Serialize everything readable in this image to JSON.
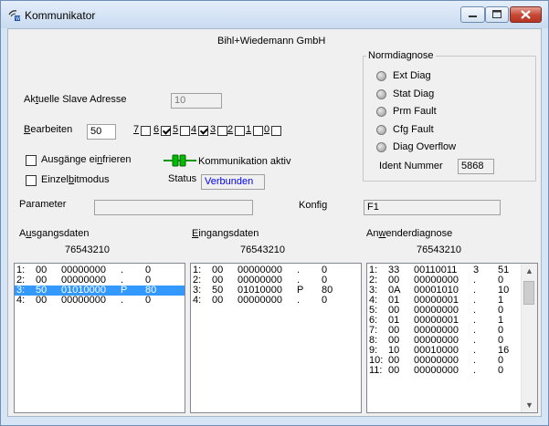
{
  "window": {
    "title": "Kommunikator"
  },
  "header": {
    "company": "Bihl+Wiedemann GmbH"
  },
  "slave": {
    "label_pre": "Ak",
    "label_u": "t",
    "label_post": "uelle Slave Adresse",
    "value": "10"
  },
  "edit": {
    "label_u": "B",
    "label_post": "earbeiten",
    "value": "50"
  },
  "bits": [
    {
      "label": "7",
      "checked": false
    },
    {
      "label": "6",
      "checked": true
    },
    {
      "label": "5",
      "checked": false
    },
    {
      "label": "4",
      "checked": true
    },
    {
      "label": "3",
      "checked": false
    },
    {
      "label": "2",
      "checked": false
    },
    {
      "label": "1",
      "checked": false
    },
    {
      "label": "0",
      "checked": false
    }
  ],
  "options": {
    "freeze_pre": "Ausgänge ei",
    "freeze_u": "n",
    "freeze_post": "frieren",
    "bit_pre": "Einzel",
    "bit_u": "b",
    "bit_post": "itmodus"
  },
  "comm": {
    "label": "Kommunikation aktiv",
    "status_label": "Status",
    "status_value": "Verbunden",
    "status_color": "#0000ff"
  },
  "norm": {
    "title": "Normdiagnose",
    "items": [
      "Ext Diag",
      "Stat Diag",
      "Prm Fault",
      "Cfg Fault",
      "Diag Overflow"
    ],
    "ident_label": "Ident Nummer",
    "ident_value": "5868"
  },
  "parameter": {
    "label": "Parameter",
    "value": ""
  },
  "konfig": {
    "label": "Konfig",
    "value": "F1"
  },
  "output": {
    "title_pre": "A",
    "title_u": "u",
    "title_post": "sgangsdaten",
    "bits_header": "76543210",
    "rows": [
      [
        "1:",
        "00",
        "00000000",
        ".",
        "0"
      ],
      [
        "2:",
        "00",
        "00000000",
        ".",
        "0"
      ],
      [
        "3:",
        "50",
        "01010000",
        "P",
        "80"
      ],
      [
        "4:",
        "00",
        "00000000",
        ".",
        "0"
      ]
    ],
    "selected": 2
  },
  "input": {
    "title_u": "E",
    "title_post": "ingangsdaten",
    "bits_header": "76543210",
    "rows": [
      [
        "1:",
        "00",
        "00000000",
        ".",
        "0"
      ],
      [
        "2:",
        "00",
        "00000000",
        ".",
        "0"
      ],
      [
        "3:",
        "50",
        "01010000",
        "P",
        "80"
      ],
      [
        "4:",
        "00",
        "00000000",
        ".",
        "0"
      ]
    ]
  },
  "user_diag": {
    "title_pre": "An",
    "title_u": "w",
    "title_post": "enderdiagnose",
    "bits_header": "76543210",
    "rows": [
      [
        "1:",
        "33",
        "00110011",
        "3",
        "51"
      ],
      [
        "2:",
        "00",
        "00000000",
        ".",
        "0"
      ],
      [
        "3:",
        "0A",
        "00001010",
        ".",
        "10"
      ],
      [
        "4:",
        "01",
        "00000001",
        ".",
        "1"
      ],
      [
        "5:",
        "00",
        "00000000",
        ".",
        "0"
      ],
      [
        "6:",
        "01",
        "00000001",
        ".",
        "1"
      ],
      [
        "7:",
        "00",
        "00000000",
        ".",
        "0"
      ],
      [
        "8:",
        "00",
        "00000000",
        ".",
        "0"
      ],
      [
        "9:",
        "10",
        "00010000",
        ".",
        "16"
      ],
      [
        "10:",
        "00",
        "00000000",
        ".",
        "0"
      ],
      [
        "11:",
        "00",
        "00000000",
        ".",
        "0"
      ]
    ]
  }
}
